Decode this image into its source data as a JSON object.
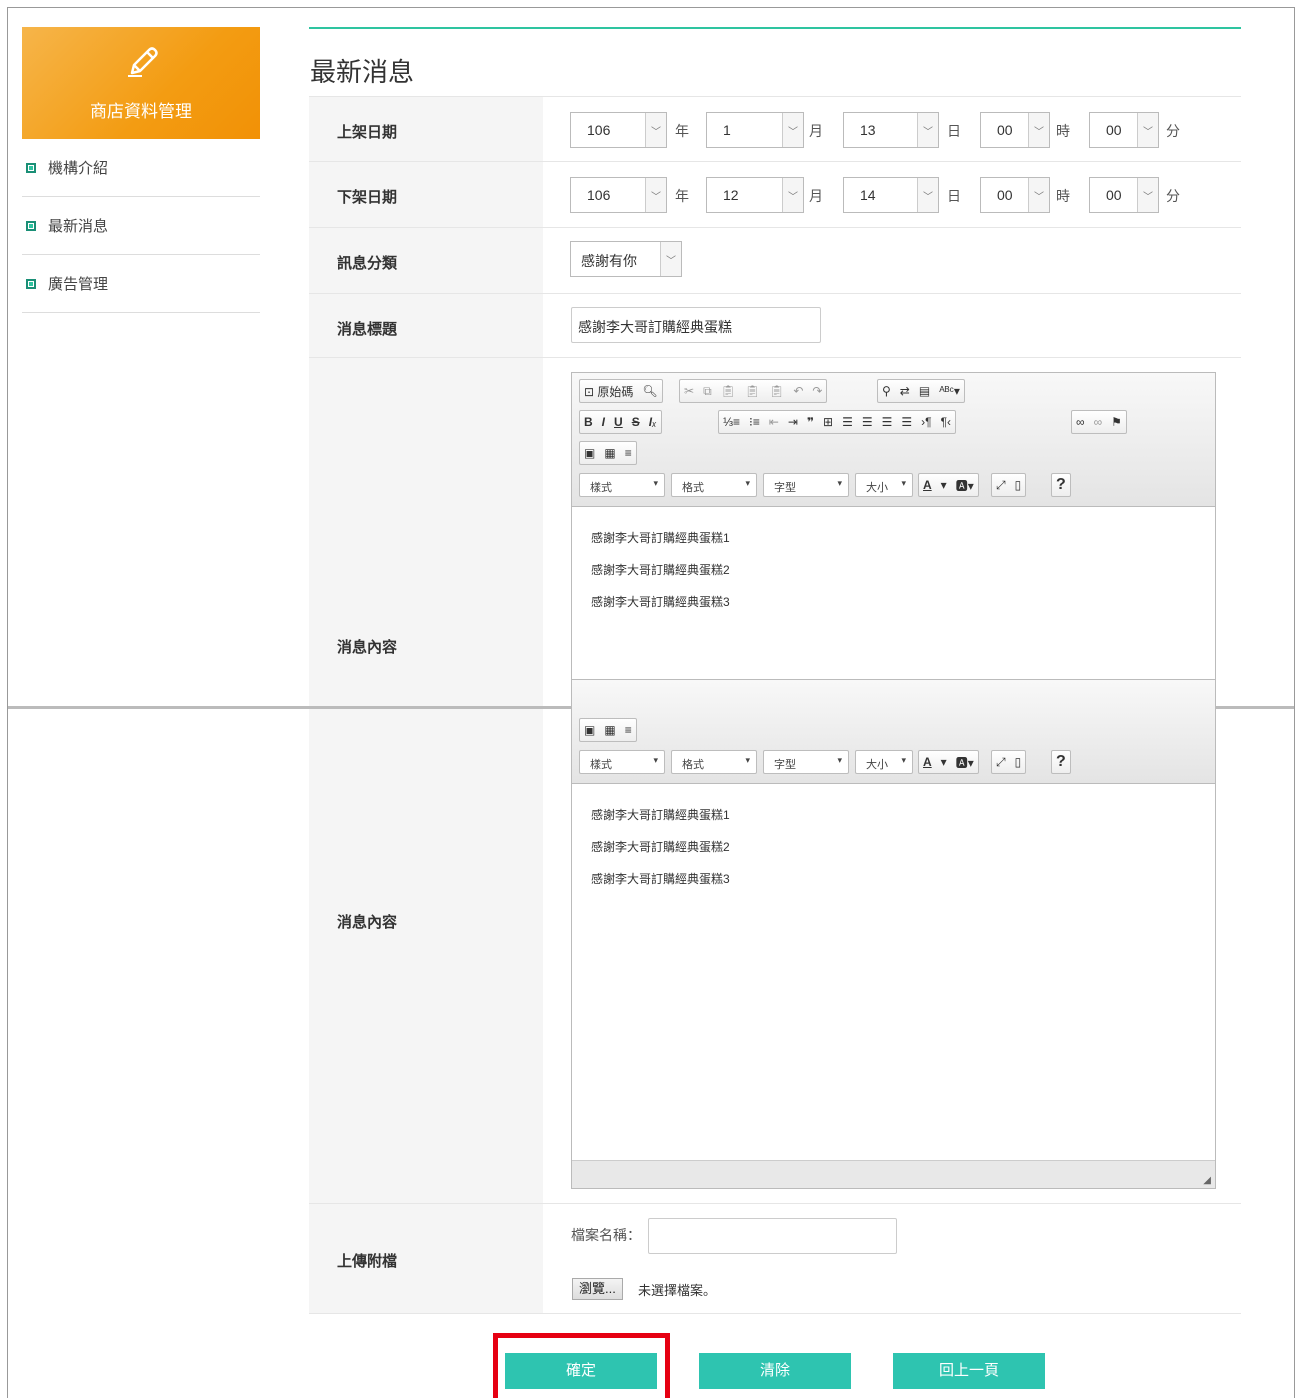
{
  "sidebar": {
    "title": "商店資料管理",
    "items": [
      {
        "label": "機構介紹"
      },
      {
        "label": "最新消息"
      },
      {
        "label": "廣告管理"
      }
    ]
  },
  "page": {
    "title": "最新消息"
  },
  "form": {
    "start_date": {
      "label": "上架日期",
      "year": "106",
      "month": "1",
      "day": "13",
      "hour": "00",
      "minute": "00"
    },
    "end_date": {
      "label": "下架日期",
      "year": "106",
      "month": "12",
      "day": "14",
      "hour": "00",
      "minute": "00"
    },
    "units": {
      "year": "年",
      "month": "月",
      "day": "日",
      "hour": "時",
      "minute": "分"
    },
    "category": {
      "label": "訊息分類",
      "value": "感謝有你"
    },
    "subject": {
      "label": "消息標題",
      "value": "感謝李大哥訂購經典蛋糕"
    },
    "content": {
      "label": "消息內容",
      "lines": [
        "感謝李大哥訂購經典蛋糕1",
        "感謝李大哥訂購經典蛋糕2",
        "感謝李大哥訂購經典蛋糕3"
      ]
    },
    "editor": {
      "source_label": "原始碼",
      "styles": "樣式",
      "format": "格式",
      "font": "字型",
      "size": "大小",
      "help": "?"
    },
    "upload": {
      "label": "上傳附檔",
      "filename_label": "檔案名稱：",
      "browse": "瀏覽...",
      "no_file": "未選擇檔案。"
    }
  },
  "buttons": {
    "confirm": "確定",
    "clear": "清除",
    "back": "回上一頁"
  },
  "colors": {
    "accent": "#2ec4b0",
    "sidebar_header": "#f39c12",
    "highlight": "#e60012"
  }
}
